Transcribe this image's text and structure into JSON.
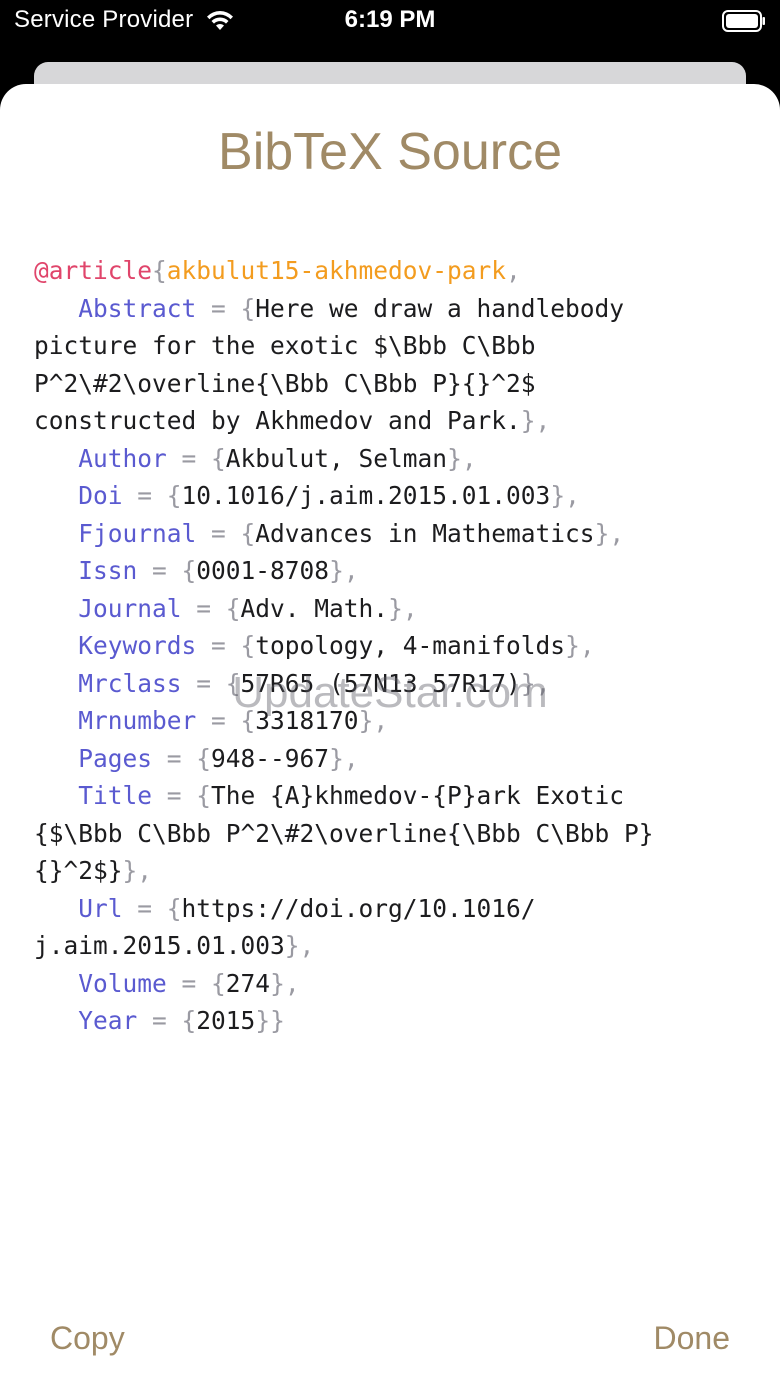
{
  "status_bar": {
    "carrier": "Service Provider",
    "time": "6:19 PM"
  },
  "sheet": {
    "title": "BibTeX Source",
    "copy_label": "Copy",
    "done_label": "Done"
  },
  "bibtex": {
    "entry_type": "@article",
    "brace_open": "{",
    "key": "akbulut15-akhmedov-park",
    "comma": ",",
    "abstract_field": "Abstract",
    "abstract_val_1": "Here we draw a handlebody",
    "abstract_val_2": "picture for the exotic $\\Bbb C\\Bbb",
    "abstract_val_3": "P^2\\#2\\overline{\\Bbb C\\Bbb P}{}^2$",
    "abstract_val_4": "constructed by Akhmedov and Park.",
    "author_field": "Author",
    "author_val": "Akbulut, Selman",
    "doi_field": "Doi",
    "doi_val": "10.1016/j.aim.2015.01.003",
    "fjournal_field": "Fjournal",
    "fjournal_val": "Advances in Mathematics",
    "issn_field": "Issn",
    "issn_val": "0001-8708",
    "journal_field": "Journal",
    "journal_val": "Adv. Math.",
    "keywords_field": "Keywords",
    "keywords_val": "topology, 4-manifolds",
    "mrclass_field": "Mrclass",
    "mrclass_val": "57R65 (57N13 57R17)",
    "mrnumber_field": "Mrnumber",
    "mrnumber_val": "3318170",
    "pages_field": "Pages",
    "pages_val": "948--967",
    "title_field": "Title",
    "title_val_1": "The {A}khmedov-{P}ark Exotic",
    "title_val_2": "{$\\Bbb C\\Bbb P^2\\#2\\overline{\\Bbb C\\Bbb P}",
    "title_val_3": "{}^2$}",
    "url_field": "Url",
    "url_val_1": "https://doi.org/10.1016/",
    "url_val_2": "j.aim.2015.01.003",
    "volume_field": "Volume",
    "volume_val": "274",
    "year_field": "Year",
    "year_val": "2015",
    "eq": " = {",
    "close_comma": "},",
    "close_final": "}}"
  },
  "watermark": "UpdateStar.com",
  "colors": {
    "accent": "#a08a66",
    "entry_type": "#e0456b",
    "citation_key": "#f39c1f",
    "field_name": "#5a5ad0",
    "punctuation": "#9a9aa2"
  }
}
